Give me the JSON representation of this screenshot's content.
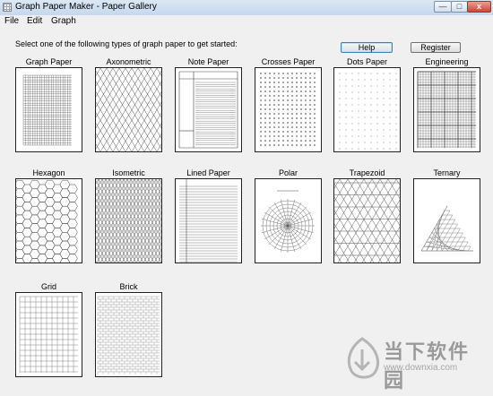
{
  "window": {
    "title": "Graph Paper Maker - Paper Gallery",
    "minimize": "—",
    "maximize": "□",
    "close": "x"
  },
  "menu": {
    "file": "File",
    "edit": "Edit",
    "graph": "Graph"
  },
  "header": {
    "prompt": "Select one of the following types of graph paper to get started:",
    "help_label": "Help",
    "register_label": "Register"
  },
  "papers": [
    {
      "label": "Graph Paper",
      "type": "graph"
    },
    {
      "label": "Axonometric",
      "type": "axonometric"
    },
    {
      "label": "Note Paper",
      "type": "note"
    },
    {
      "label": "Crosses Paper",
      "type": "crosses"
    },
    {
      "label": "Dots Paper",
      "type": "dots"
    },
    {
      "label": "Engineering",
      "type": "engineering"
    },
    {
      "label": "Hexagon",
      "type": "hexagon"
    },
    {
      "label": "Isometric",
      "type": "isometric"
    },
    {
      "label": "Lined Paper",
      "type": "lined"
    },
    {
      "label": "Polar",
      "type": "polar"
    },
    {
      "label": "Trapezoid",
      "type": "trapezoid"
    },
    {
      "label": "Ternary",
      "type": "ternary"
    },
    {
      "label": "Grid",
      "type": "grid"
    },
    {
      "label": "Brick",
      "type": "brick"
    }
  ],
  "watermark": {
    "brand": "当下软件园",
    "url": "www.downxia.com"
  }
}
